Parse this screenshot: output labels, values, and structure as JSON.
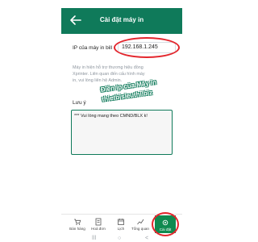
{
  "header": {
    "title": "Cài đặt máy in"
  },
  "form": {
    "ip_label": "IP của máy in bill",
    "ip_value": "192.168.1.245",
    "description": [
      "Máy in hiện hỗ trợ thương hiệu đồng",
      "Xprinter. Liên quan đến cấu hình máy",
      "in, vui lòng liên hệ Admin."
    ],
    "note_label": "Lưu ý",
    "note_value": "*** Vui lòng mang theo CMND/BLX k!"
  },
  "overlay": {
    "line1": "Điền Ip của Máy in",
    "line2": "thietbisieuthi.biz"
  },
  "bottom_nav": {
    "items": [
      {
        "label": "Bán hàng",
        "icon": "cart-icon"
      },
      {
        "label": "Hoá đơn",
        "icon": "receipt-icon"
      },
      {
        "label": "Lịch",
        "icon": "calendar-icon"
      },
      {
        "label": "Tổng quan",
        "icon": "chart-icon"
      },
      {
        "label": "Cài đặt",
        "icon": "gear-icon",
        "active": true
      }
    ]
  },
  "system_nav": {
    "recents": "|||",
    "home": "○",
    "back": "<"
  },
  "colors": {
    "primary": "#0f7a5a",
    "accent": "#0f8a4f",
    "highlight": "#e3262d"
  }
}
